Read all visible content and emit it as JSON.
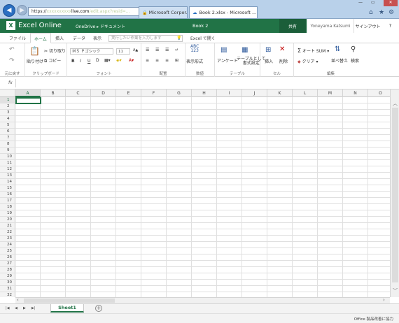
{
  "browser": {
    "address_prefix": "https://",
    "address_blur": "xxxxxxxxxx",
    "address_host": "live.com",
    "address_rest": "/edit.aspx?resid=...",
    "tab1_title": "Microsoft Corpor...",
    "tab2_title": "Book 2.xlsx - Microsoft ..."
  },
  "excel": {
    "app_name": "Excel Online",
    "breadcrumb": "OneDrive ▸ ドキュメント",
    "book_name": "Book 2",
    "share_label": "共有",
    "user_name": "Yoneyama Katsumi",
    "signout_label": "サインアウト",
    "help_label": "?"
  },
  "ribbon_tabs": {
    "file": "ファイル",
    "home": "ホーム",
    "insert": "挿入",
    "data": "データ",
    "view": "表示",
    "tellme_placeholder": "実行したい作業を入力します",
    "open_in_excel": "Excel で開く"
  },
  "ribbon": {
    "undo_label": "元に戻す",
    "paste_label": "貼り付け",
    "cut_label": "切り取り",
    "copy_label": "コピー",
    "clipboard_label": "クリップボード",
    "font_name": "ＭＳ Ｐゴシック",
    "font_size": "11",
    "bold": "B",
    "italic": "I",
    "underline": "U",
    "font_label": "フォント",
    "alignment_label": "配置",
    "number_icon": "ABC\n123",
    "number_format_label": "表示形式",
    "number_label": "数値",
    "survey_label": "アンケート",
    "format_table_label": "テーブルとして\n書式設定",
    "table_label": "テーブル",
    "insert_label": "挿入",
    "delete_label": "削除",
    "cells_label": "セル",
    "autosum_label": "オート SUM",
    "clear_label": "クリア",
    "sort_label": "並べ替え",
    "find_label": "検索",
    "editing_label": "編集"
  },
  "formula_bar": {
    "fx_label": "fx",
    "value": ""
  },
  "grid": {
    "columns": [
      "A",
      "B",
      "C",
      "D",
      "E",
      "F",
      "G",
      "H",
      "I",
      "J",
      "K",
      "L",
      "M",
      "N",
      "O"
    ],
    "rows": [
      "1",
      "2",
      "3",
      "4",
      "5",
      "6",
      "7",
      "8",
      "9",
      "10",
      "11",
      "12",
      "13",
      "14",
      "15",
      "16",
      "17",
      "18",
      "19",
      "20",
      "21",
      "22",
      "23",
      "24",
      "25",
      "26",
      "27",
      "28",
      "29",
      "30",
      "31",
      "32"
    ],
    "active_cell": "A1"
  },
  "sheets": {
    "tabs": [
      "Sheet1"
    ],
    "add_symbol": "+"
  },
  "status": {
    "text": "Office 製品改善に協力"
  }
}
